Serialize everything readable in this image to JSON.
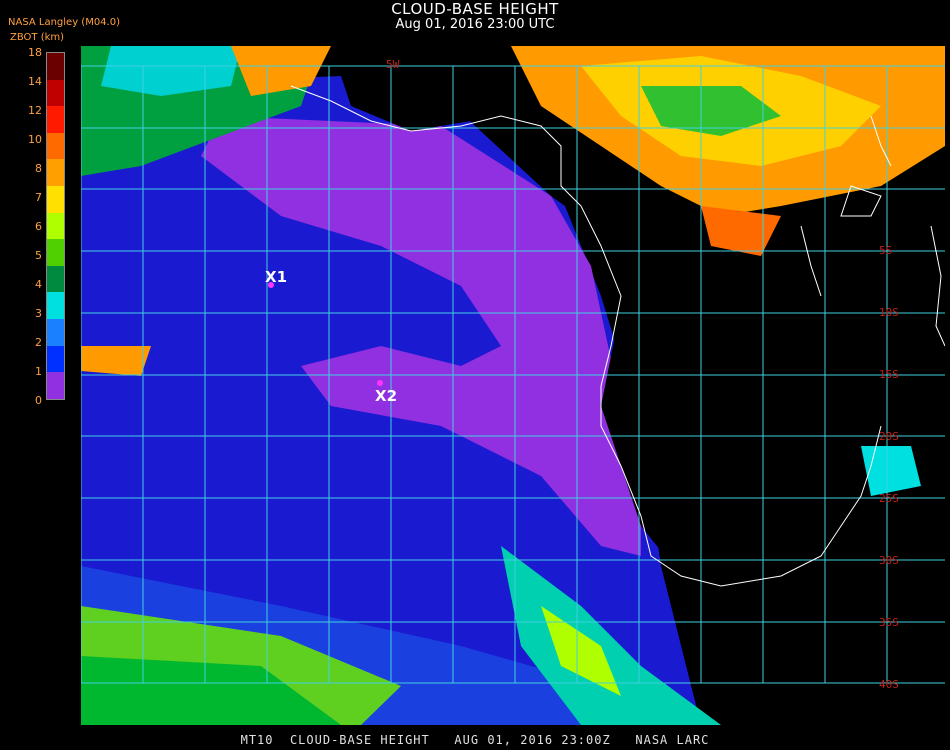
{
  "header": {
    "title": "CLOUD-BASE HEIGHT",
    "datetime": "Aug 01, 2016 23:00 UTC",
    "org": "NASA Langley (M04.0)",
    "unit": "ZBOT (km)"
  },
  "legend": {
    "ticks": [
      "18",
      "14",
      "12",
      "10",
      "8",
      "7",
      "6",
      "5",
      "4",
      "3",
      "2",
      "1",
      "0"
    ],
    "colors": [
      "#6b0000",
      "#c00000",
      "#ff1a00",
      "#ff6a00",
      "#ffa000",
      "#ffe000",
      "#b0ff00",
      "#50d000",
      "#008a40",
      "#00e0e0",
      "#1a80ff",
      "#0030ff",
      "#9030e0"
    ]
  },
  "map": {
    "lat_labels": [
      "5S",
      "10S",
      "15S",
      "20S",
      "25S",
      "30S",
      "35S",
      "40S"
    ],
    "top_labels": [
      "5W"
    ],
    "points": [
      {
        "label": "X1",
        "color": "#ff33ff"
      },
      {
        "label": "X2",
        "color": "#ff33ff"
      }
    ],
    "grid_color": "#40d0e0",
    "coast_color": "#ffffff"
  },
  "footer": {
    "text": "MT10  CLOUD-BASE HEIGHT   AUG 01, 2016 23:00Z   NASA LARC"
  }
}
